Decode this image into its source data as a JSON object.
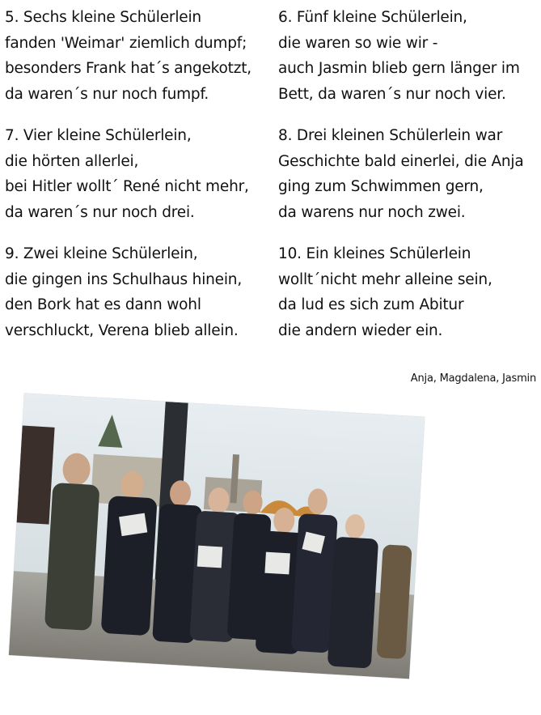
{
  "stanzas": [
    {
      "id": "s5",
      "lines": [
        "5. Sechs kleine Schülerlein",
        "fanden 'Weimar' ziemlich dumpf;",
        "besonders Frank hat´s angekotzt,",
        "da waren´s nur noch fumpf."
      ]
    },
    {
      "id": "s6",
      "lines": [
        "6. Fünf kleine Schülerlein,",
        "die waren so wie wir -",
        "auch Jasmin blieb gern länger im",
        "Bett, da waren´s nur noch vier."
      ]
    },
    {
      "id": "s7",
      "lines": [
        "7. Vier kleine Schülerlein,",
        "die hörten allerlei,",
        "bei Hitler wollt´ René nicht mehr,",
        "da waren´s nur noch drei."
      ]
    },
    {
      "id": "s8",
      "lines": [
        "8. Drei kleinen Schülerlein war",
        "Geschichte bald einerlei, die Anja",
        "ging zum Schwimmen gern,",
        "da warens nur noch zwei."
      ]
    },
    {
      "id": "s9",
      "lines": [
        "9. Zwei kleine Schülerlein,",
        "die gingen ins Schulhaus hinein,",
        "den Bork hat es dann wohl",
        "verschluckt, Verena blieb allein."
      ]
    },
    {
      "id": "s10",
      "lines": [
        "10. Ein kleines Schülerlein",
        "wollt´nicht mehr alleine sein,",
        "da lud es sich zum Abitur",
        "die andern wieder ein."
      ]
    }
  ],
  "authors": "Anja, Magdalena, Jasmin",
  "photo": {
    "subject": "group of students standing outdoors holding booklets",
    "colors": {
      "sky": "#dfe6ea",
      "ground": "#9a9a94",
      "clothing": "#1c1f28"
    }
  }
}
